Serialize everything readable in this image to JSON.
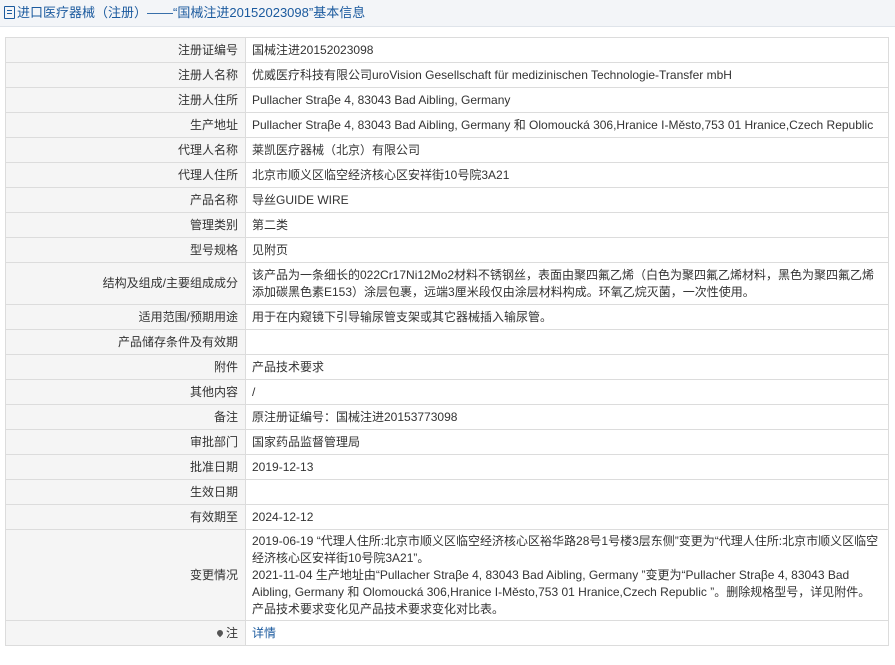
{
  "header": {
    "prefix": "进口医疗器械（注册）",
    "separator": "——",
    "title": "“国械注进20152023098”基本信息"
  },
  "rows": [
    {
      "label": "注册证编号",
      "value": "国械注进20152023098"
    },
    {
      "label": "注册人名称",
      "value": "优威医疗科技有限公司uroVision Gesellschaft für medizinischen Technologie-Transfer mbH"
    },
    {
      "label": "注册人住所",
      "value": "Pullacher Straβe 4, 83043 Bad Aibling, Germany"
    },
    {
      "label": "生产地址",
      "value": "Pullacher Straβe 4, 83043 Bad Aibling, Germany 和 Olomoucká 306,Hranice I-Město,753 01 Hranice,Czech Republic"
    },
    {
      "label": "代理人名称",
      "value": "莱凯医疗器械（北京）有限公司"
    },
    {
      "label": "代理人住所",
      "value": "北京市顺义区临空经济核心区安祥街10号院3A21"
    },
    {
      "label": "产品名称",
      "value": "导丝GUIDE WIRE"
    },
    {
      "label": "管理类别",
      "value": "第二类"
    },
    {
      "label": "型号规格",
      "value": "见附页"
    },
    {
      "label": "结构及组成/主要组成成分",
      "value": "该产品为一条细长的022Cr17Ni12Mo2材料不锈钢丝，表面由聚四氟乙烯（白色为聚四氟乙烯材料，黑色为聚四氟乙烯添加碳黑色素E153）涂层包裹，远端3厘米段仅由涂层材料构成。环氧乙烷灭菌，一次性使用。"
    },
    {
      "label": "适用范围/预期用途",
      "value": "用于在内窥镜下引导输尿管支架或其它器械插入输尿管。"
    },
    {
      "label": "产品储存条件及有效期",
      "value": ""
    },
    {
      "label": "附件",
      "value": "产品技术要求"
    },
    {
      "label": "其他内容",
      "value": "/"
    },
    {
      "label": "备注",
      "value": "原注册证编号：国械注进20153773098"
    },
    {
      "label": "审批部门",
      "value": "国家药品监督管理局"
    },
    {
      "label": "批准日期",
      "value": "2019-12-13"
    },
    {
      "label": "生效日期",
      "value": ""
    },
    {
      "label": "有效期至",
      "value": "2024-12-12"
    }
  ],
  "changes": {
    "label": "变更情况",
    "entry1": "2019-06-19 “代理人住所:北京市顺义区临空经济核心区裕华路28号1号楼3层东侧”变更为“代理人住所:北京市顺义区临空经济核心区安祥街10号院3A21”。",
    "entry2": "2021-11-04 生产地址由“Pullacher Straβe 4, 83043 Bad Aibling, Germany ”变更为“Pullacher Straβe 4, 83043 Bad Aibling, Germany 和 Olomoucká 306,Hranice I-Město,753 01 Hranice,Czech Republic ”。删除规格型号，详见附件。产品技术要求变化见产品技术要求变化对比表。"
  },
  "note": {
    "icon": "pin-icon",
    "label": "注",
    "link_text": "详情"
  },
  "colors": {
    "header_text": "#1b5a9e",
    "header_bg": "#f3f5f8",
    "label_bg": "#f5f5f5",
    "border": "#dcdcdc",
    "link": "#1b5a9e"
  }
}
